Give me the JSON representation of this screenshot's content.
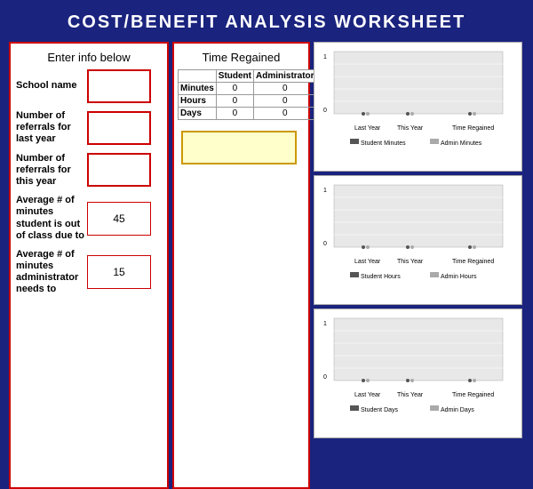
{
  "title": "COST/BENEFIT ANALYSIS WORKSHEET",
  "left_panel": {
    "header": "Enter info below",
    "fields": [
      {
        "label": "School name",
        "value": "",
        "has_input": true
      },
      {
        "label": "Number of referrals for last year",
        "value": "",
        "has_input": true
      },
      {
        "label": "Number of referrals for this year",
        "value": "",
        "has_input": true
      },
      {
        "label": "Average # of minutes student is out of class due to",
        "value": "45",
        "has_input": false
      },
      {
        "label": "Average # of minutes administrator needs to",
        "value": "15",
        "has_input": false
      }
    ]
  },
  "middle_panel": {
    "header": "Time Regained",
    "table": {
      "headers": [
        "",
        "Student",
        "Administrator"
      ],
      "rows": [
        {
          "label": "Minutes",
          "student": "0",
          "admin": "0"
        },
        {
          "label": "Hours",
          "student": "0",
          "admin": "0"
        },
        {
          "label": "Days",
          "student": "0",
          "admin": "0"
        }
      ]
    }
  },
  "charts": [
    {
      "id": "minutes-chart",
      "legend": [
        "Student Minutes",
        "Admin Minutes"
      ],
      "x_labels": [
        "Last Year",
        "This Year",
        "Time Regained"
      ],
      "y_max": 1,
      "y_labels": [
        "1",
        "",
        "",
        "",
        "",
        "0"
      ],
      "data_points": [
        {
          "x_label": "Last Year",
          "student": 0,
          "admin": 0
        },
        {
          "x_label": "This Year",
          "student": 0,
          "admin": 0
        },
        {
          "x_label": "Time Regained",
          "student": 0,
          "admin": 0
        }
      ]
    },
    {
      "id": "hours-chart",
      "legend": [
        "Student Hours",
        "Admin Hours"
      ],
      "x_labels": [
        "Last Year",
        "This Year",
        "Time Regained"
      ],
      "y_max": 1,
      "y_labels": [
        "1",
        "",
        "",
        "",
        "",
        "0"
      ],
      "data_points": []
    },
    {
      "id": "days-chart",
      "legend": [
        "Student Days",
        "Admin Days"
      ],
      "x_labels": [
        "Last Year",
        "This Year",
        "Time Regained"
      ],
      "y_max": 1,
      "y_labels": [
        "1",
        "",
        "",
        "",
        "",
        "0"
      ],
      "data_points": []
    }
  ],
  "colors": {
    "background": "#1a237e",
    "border_red": "#cc0000",
    "student_bar": "#999999",
    "admin_bar": "#cccccc",
    "chart_bg": "#ffffff"
  }
}
